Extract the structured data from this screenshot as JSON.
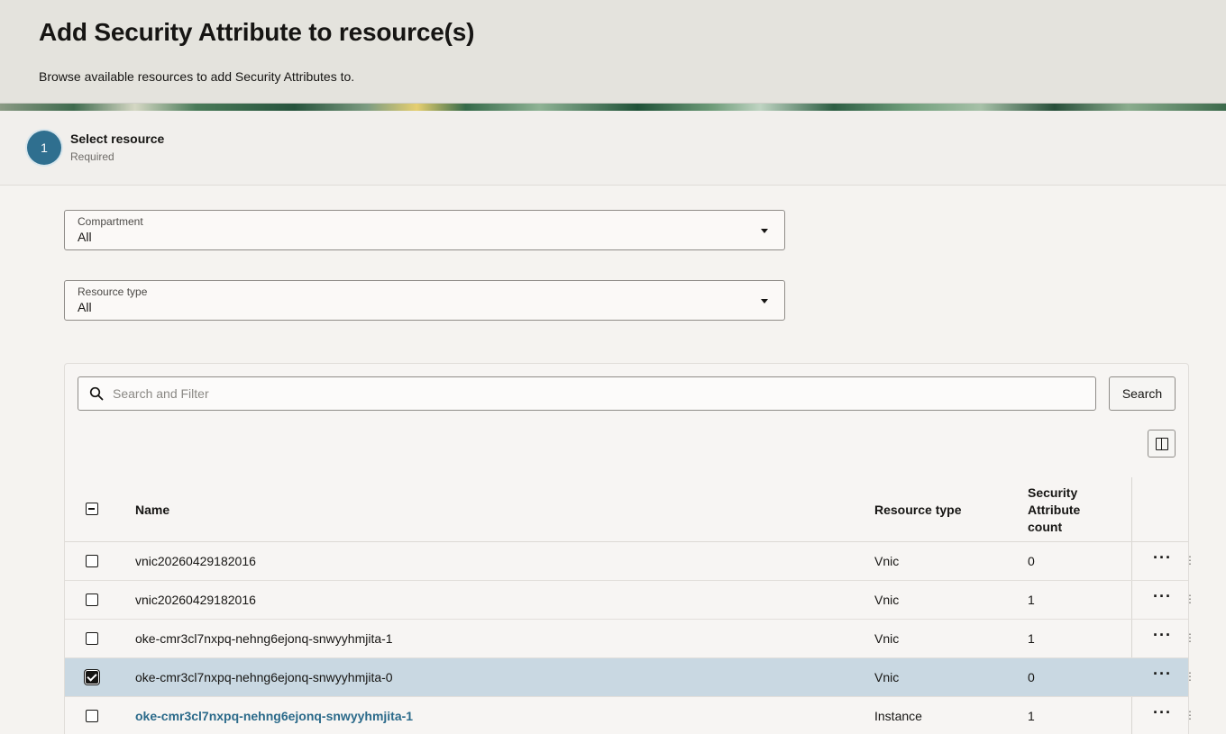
{
  "header": {
    "title": "Add Security Attribute to resource(s)",
    "subtitle": "Browse available resources to add Security Attributes to."
  },
  "step": {
    "number": "1",
    "title": "Select resource",
    "status": "Required"
  },
  "filters": {
    "compartment": {
      "label": "Compartment",
      "value": "All"
    },
    "resource_type": {
      "label": "Resource type",
      "value": "All"
    }
  },
  "search": {
    "placeholder": "Search and Filter",
    "button_label": "Search"
  },
  "table": {
    "columns": {
      "name": "Name",
      "resource_type": "Resource type",
      "count_line1": "Security",
      "count_line2": "Attribute",
      "count_line3": "count"
    },
    "more_glyph": "···",
    "grip_glyph": "⋮",
    "rows": [
      {
        "name": "vnic20260429182016",
        "type": "Vnic",
        "count": "0",
        "checked": false
      },
      {
        "name": "vnic20260429182016",
        "type": "Vnic",
        "count": "1",
        "checked": false
      },
      {
        "name": "oke-cmr3cl7nxpq-nehng6ejonq-snwyyhmjita-1",
        "type": "Vnic",
        "count": "1",
        "checked": false
      },
      {
        "name": "oke-cmr3cl7nxpq-nehng6ejonq-snwyyhmjita-0",
        "type": "Vnic",
        "count": "0",
        "checked": true
      },
      {
        "name": "oke-cmr3cl7nxpq-nehng6ejonq-snwyyhmjita-1",
        "type": "Instance",
        "count": "1",
        "checked": false,
        "link": true
      }
    ]
  },
  "colors": {
    "accent": "#2f6f8f",
    "link": "#2b6a8a",
    "selected_row": "#c9d8e2"
  }
}
